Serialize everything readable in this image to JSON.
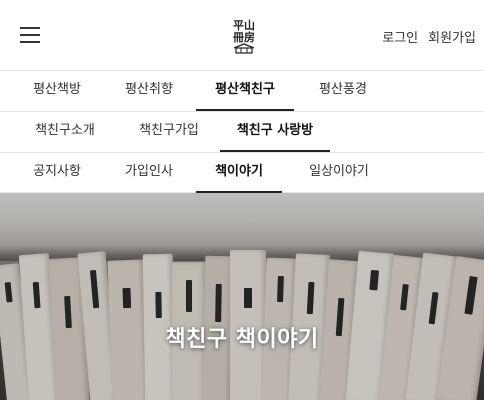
{
  "header": {
    "logo_text": "平山\n冊房",
    "login_label": "로그인",
    "signup_label": "회원가입"
  },
  "nav": {
    "primary": [
      "평산책방",
      "평산취향",
      "평산책친구",
      "평산풍경"
    ],
    "primary_active": 2,
    "secondary": [
      "책친구소개",
      "책친구가입",
      "책친구 사랑방"
    ],
    "secondary_active": 2,
    "tertiary": [
      "공지사항",
      "가입인사",
      "책이야기",
      "일상이야기"
    ],
    "tertiary_active": 2
  },
  "hero": {
    "title": "책친구 책이야기"
  },
  "colors": {
    "text": "#333333",
    "active_underline": "#222222",
    "divider": "#e4e4e4"
  },
  "icons": {
    "menu": "hamburger-icon"
  }
}
